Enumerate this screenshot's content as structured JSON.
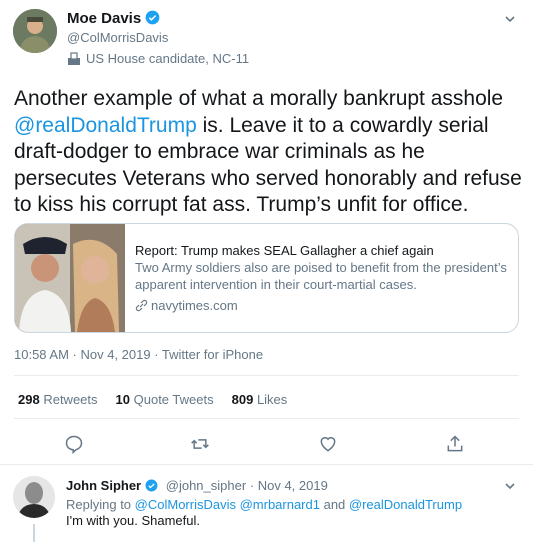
{
  "tweet": {
    "author_name": "Moe Davis",
    "handle": "@ColMorrisDavis",
    "label": "US House candidate, NC-11",
    "text_part1": "Another example of what a morally bankrupt asshole ",
    "mention": "@realDonaldTrump",
    "text_part2": " is.  Leave it to a cowardly serial draft-dodger to embrace war criminals as he persecutes Veterans who served honorably and refuse to kiss his corrupt fat ass.  Trump’s unfit for office.",
    "card": {
      "title": "Report: Trump makes SEAL Gallagher a chief again",
      "description": "Two Army soldiers also are poised to benefit from the president’s apparent intervention in their court-martial cases.",
      "link": "navytimes.com"
    },
    "timestamp": "10:58 AM · Nov 4, 2019 · Twitter for iPhone",
    "stats": {
      "retweets_count": "298",
      "retweets_label": "Retweets",
      "quotes_count": "10",
      "quotes_label": "Quote Tweets",
      "likes_count": "809",
      "likes_label": "Likes"
    }
  },
  "reply": {
    "author_name": "John Sipher",
    "handle_date": "@john_sipher · Nov 4, 2019",
    "replying_prefix": "Replying to ",
    "replying_to": "@ColMorrisDavis @mrbarnard1",
    "replying_and": " and ",
    "replying_last": "@realDonaldTrump",
    "text": "I'm with you. Shameful."
  },
  "colors": {
    "accent": "#1b95e0",
    "muted": "#657786",
    "border": "#ccd6dd"
  }
}
